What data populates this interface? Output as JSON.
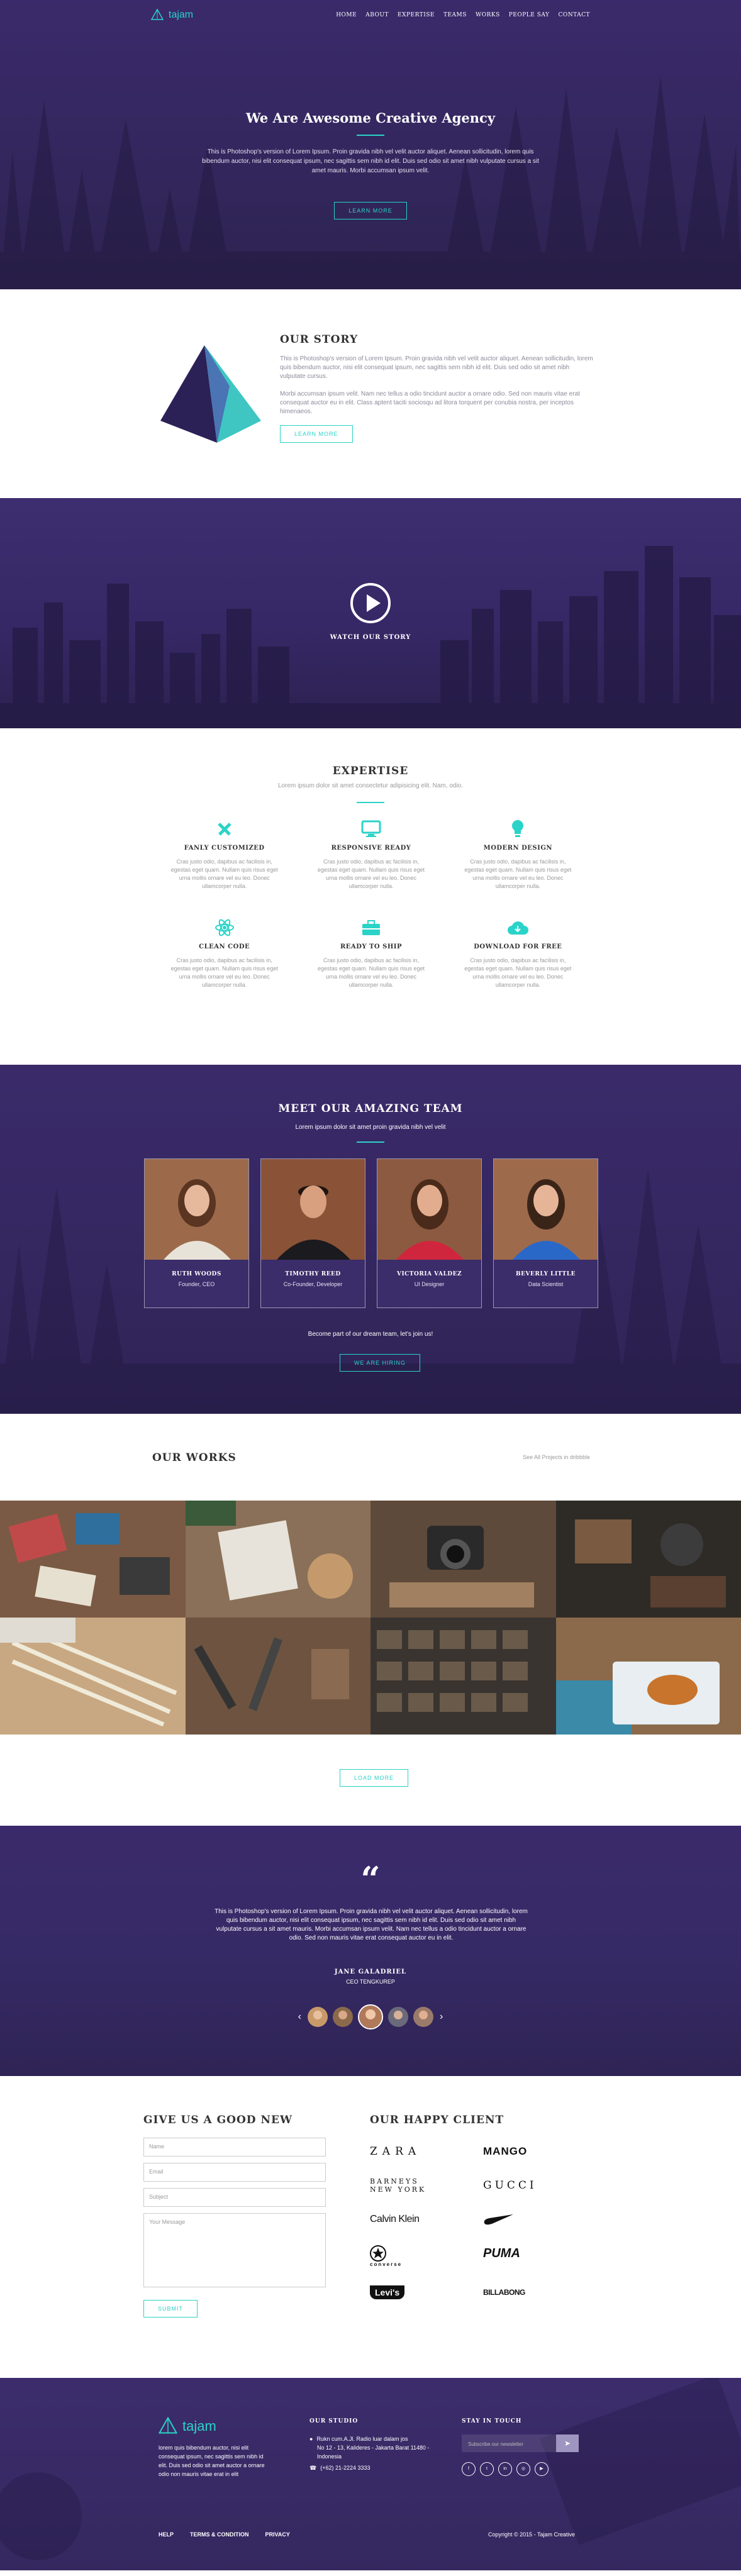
{
  "nav": {
    "logo": "tajam",
    "links": [
      "HOME",
      "ABOUT",
      "EXPERTISE",
      "TEAMS",
      "WORKS",
      "PEOPLE SAY",
      "CONTACT"
    ]
  },
  "hero": {
    "title": "We Are Awesome Creative Agency",
    "text": "This is Photoshop's version of Lorem Ipsum. Proin gravida nibh vel velit auctor aliquet. Aenean sollicitudin, lorem quis bibendum auctor, nisi elit consequat ipsum, nec sagittis sem nibh id elit. Duis sed odio sit amet nibh vulputate cursus a sit amet mauris. Morbi accumsan ipsum velit.",
    "button": "LEARN MORE"
  },
  "story": {
    "title": "OUR STORY",
    "p1": "This is Photoshop's version of Lorem Ipsum. Proin gravida nibh vel velit auctor aliquet. Aenean sollicitudin, lorem quis bibendum auctor, nisi elit consequat ipsum, nec sagittis sem nibh id elit. Duis sed odio sit amet nibh vulputate cursus.",
    "p2": "Morbi accumsan ipsum velit. Nam nec tellus a odio tincidunt auctor a ornare odio. Sed non mauris vitae erat consequat auctor eu in elit. Class aptent taciti sociosqu ad litora torquent per conubia nostra, per inceptos himenaeos.",
    "button": "LEARN MORE"
  },
  "video": {
    "label": "WATCH OUR STORY"
  },
  "expertise": {
    "title": "EXPERTISE",
    "subtitle": "Lorem ipsum dolor sit amet consectetur adipisicing elit. Nam, odio.",
    "items": [
      {
        "icon": "pencil-ruler-icon",
        "title": "FANLY CUSTOMIZED",
        "text": "Cras justo odio, dapibus ac facilisis in, egestas eget quam. Nullam quis risus eget urna mollis ornare vel eu leo. Donec ullamcorper nulla."
      },
      {
        "icon": "monitor-icon",
        "title": "RESPONSIVE READY",
        "text": "Cras justo odio, dapibus ac facilisis in, egestas eget quam. Nullam quis risus eget urna mollis ornare vel eu leo. Donec ullamcorper nulla."
      },
      {
        "icon": "lightbulb-icon",
        "title": "MODERN DESIGN",
        "text": "Cras justo odio, dapibus ac facilisis in, egestas eget quam. Nullam quis risus eget urna mollis ornare vel eu leo. Donec ullamcorper nulla."
      },
      {
        "icon": "atom-icon",
        "title": "CLEAN CODE",
        "text": "Cras justo odio, dapibus ac facilisis in, egestas eget quam. Nullam quis risus eget urna mollis ornare vel eu leo. Donec ullamcorper nulla."
      },
      {
        "icon": "toolbox-icon",
        "title": "READY TO SHIP",
        "text": "Cras justo odio, dapibus ac facilisis in, egestas eget quam. Nullam quis risus eget urna mollis ornare vel eu leo. Donec ullamcorper nulla."
      },
      {
        "icon": "cloud-download-icon",
        "title": "DOWNLOAD FOR FREE",
        "text": "Cras justo odio, dapibus ac facilisis in, egestas eget quam. Nullam quis risus eget urna mollis ornare vel eu leo. Donec ullamcorper nulla."
      }
    ]
  },
  "team": {
    "title": "MEET OUR AMAZING TEAM",
    "subtitle": "Lorem ipsum dolor sit amet proin gravida nibh vel velit",
    "members": [
      {
        "name": "RUTH WOODS",
        "role": "Founder, CEO"
      },
      {
        "name": "TIMOTHY REED",
        "role": "Co-Founder, Developer"
      },
      {
        "name": "VICTORIA VALDEZ",
        "role": "UI Designer"
      },
      {
        "name": "BEVERLY LITTLE",
        "role": "Data Scientist"
      }
    ],
    "cta": "Become part of our dream team, let's join us!",
    "button": "WE ARE HIRING"
  },
  "works": {
    "title": "OUR WORKS",
    "see_all": "See All Projects in dribbble",
    "button": "LOAD MORE"
  },
  "testimonial": {
    "quote": "This is Photoshop's version of Lorem Ipsum. Proin gravida nibh vel velit auctor aliquet. Aenean sollicitudin, lorem quis bibendum auctor, nisi elit consequat ipsum, nec sagittis sem nibh id elit. Duis sed odio sit amet nibh vulputate cursus a sit amet mauris. Morbi accumsan ipsum velit. Nam nec tellus a odio tincidunt auctor a ornare odio. Sed non mauris vitae erat consequat auctor eu in elit.",
    "name": "JANE GALADRIEL",
    "role": "CEO TENGKUREP"
  },
  "contact": {
    "title": "GIVE US A GOOD NEW",
    "name": "Name",
    "email": "Email",
    "subject": "Subject",
    "message": "Your Message",
    "button": "SUBMIT"
  },
  "clients": {
    "title": "OUR HAPPY CLIENT",
    "logos": [
      "ZARA",
      "MANGO",
      "BARNEYS NEW YORK",
      "GUCCI",
      "Calvin Klein",
      "nike-swoosh",
      "converse",
      "PUMA",
      "Levi's",
      "BILLABONG"
    ]
  },
  "footer": {
    "logo": "tajam",
    "about": "lorem quis bibendum auctor, nisi elit consequat ipsum, nec sagittis sem nibh id elit. Duis sed odio sit amet auctor a ornare odio non mauris vitae erat in elit",
    "studio_title": "OUR STUDIO",
    "address1": "Rukn cum.A.Jl. Radio luar dalam jos",
    "address2": "No 12 - 13, Kalideres - Jakarta Barat 11480 - Indonesia",
    "phone": "(+62) 21-2224 3333",
    "touch_title": "STAY IN TOUCH",
    "subscribe_placeholder": "Subscribe our newsletter",
    "links": [
      "HELP",
      "TERMS & CONDITION",
      "PRIVACY"
    ],
    "copyright": "Copyright © 2015 - Tajam Creative"
  },
  "colors": {
    "accent": "#2ad3c8",
    "purple": "#3a2a6a"
  }
}
